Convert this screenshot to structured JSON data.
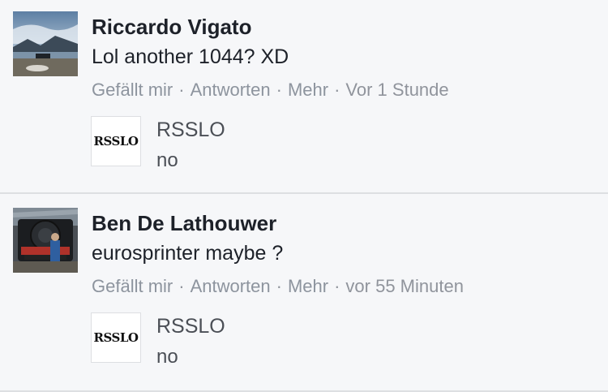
{
  "comments": [
    {
      "author": "Riccardo Vigato",
      "text": "Lol another 1044? XD",
      "actions": {
        "like": "Gefällt mir",
        "reply": "Antworten",
        "more": "Mehr",
        "separator": "·",
        "time": "Vor 1 Stunde"
      },
      "reply": {
        "avatar_text": "RSSLO",
        "author": "RSSLO",
        "text": "no"
      }
    },
    {
      "author": "Ben De Lathouwer",
      "text": "eurosprinter maybe ?",
      "actions": {
        "like": "Gefällt mir",
        "reply": "Antworten",
        "more": "Mehr",
        "separator": "·",
        "time": "vor 55 Minuten"
      },
      "reply": {
        "avatar_text": "RSSLO",
        "author": "RSSLO",
        "text": "no"
      }
    }
  ]
}
